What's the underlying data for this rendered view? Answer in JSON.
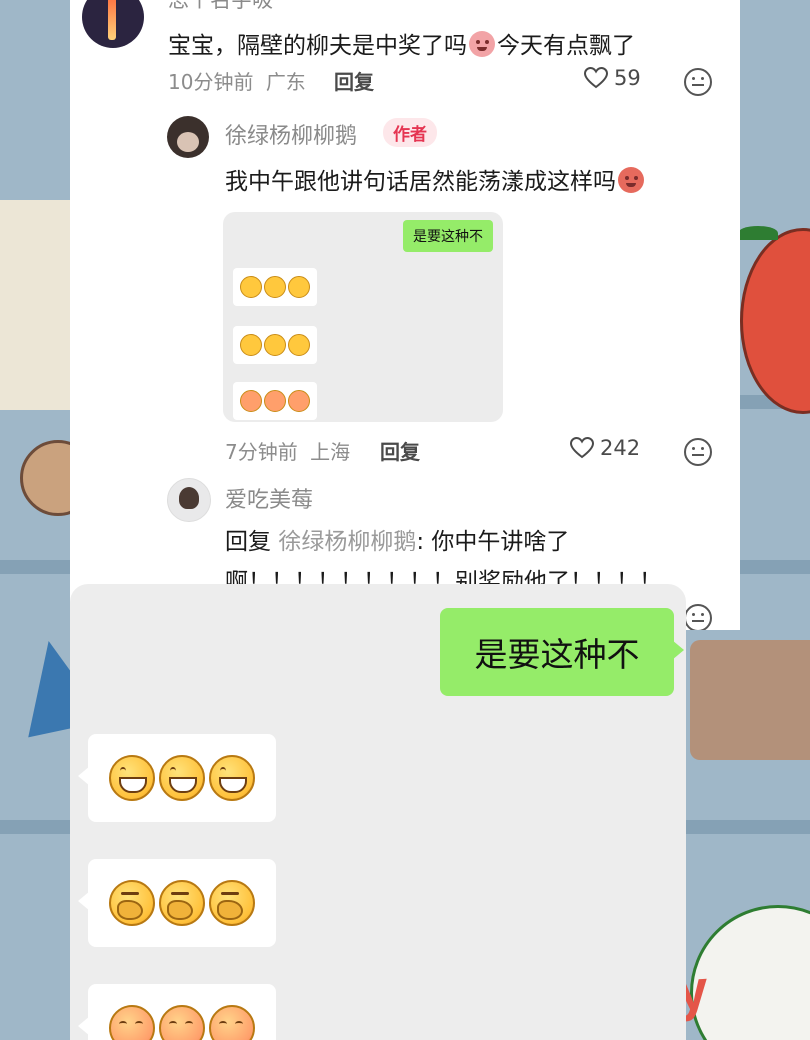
{
  "comment": {
    "username": "思个名字吸",
    "text_before_emoji": "宝宝，隔壁的柳夫是中奖了吗",
    "text_after_emoji": "今天有点飘了",
    "time": "10分钟前",
    "location": "广东",
    "reply_label": "回复",
    "likes": "59"
  },
  "author_reply": {
    "username": "徐绿杨柳柳鹅",
    "badge": "作者",
    "text": "我中午跟他讲句话居然能荡漾成这样吗",
    "time": "7分钟前",
    "location": "上海",
    "reply_label": "回复",
    "likes": "242",
    "mini_chat": {
      "green_bubble": "是要这种不"
    }
  },
  "fan_reply": {
    "username": "爱吃美莓",
    "reply_prefix": "回复",
    "reply_target": "徐绿杨柳柳鹅",
    "line1": ": 你中午讲啥了",
    "line2": "啊！！！！！！！！！别奖励他了！！！！"
  },
  "chat": {
    "green_bubble": "是要这种不",
    "emoji_rows": [
      "grin-emoji",
      "shy-cover-emoji",
      "blush-squint-emoji"
    ]
  },
  "watermark": "PPy"
}
